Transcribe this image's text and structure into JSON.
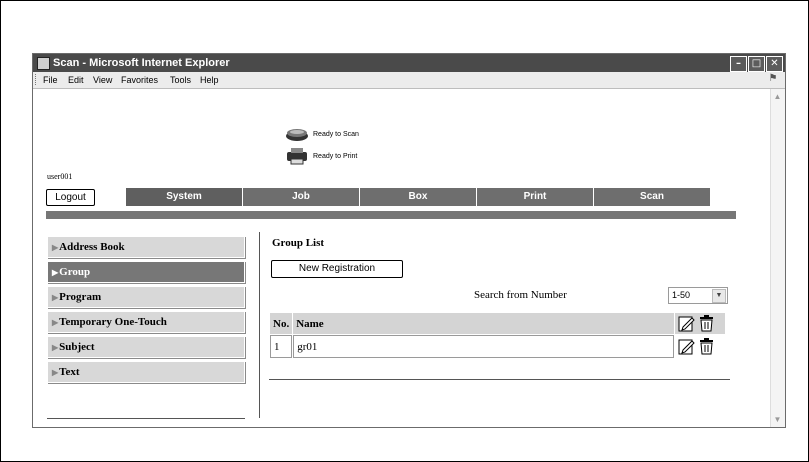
{
  "window": {
    "title": "Scan - Microsoft Internet Explorer"
  },
  "menubar": [
    "File",
    "Edit",
    "View",
    "Favorites",
    "Tools",
    "Help"
  ],
  "status": {
    "scan": "Ready to Scan",
    "print": "Ready to Print"
  },
  "user": {
    "name": "user001",
    "logout_label": "Logout"
  },
  "tabs": [
    "System",
    "Job",
    "Box",
    "Print",
    "Scan"
  ],
  "sidebar": {
    "items": [
      {
        "label": "Address Book",
        "active": false
      },
      {
        "label": "Group",
        "active": true
      },
      {
        "label": "Program",
        "active": false
      },
      {
        "label": "Temporary One-Touch",
        "active": false
      },
      {
        "label": "Subject",
        "active": false
      },
      {
        "label": "Text",
        "active": false
      }
    ]
  },
  "main": {
    "title": "Group List",
    "new_registration_label": "New Registration",
    "search_label": "Search from Number",
    "range_value": "1-50",
    "table": {
      "headers": {
        "no": "No.",
        "name": "Name"
      },
      "rows": [
        {
          "no": "1",
          "name": "gr01"
        }
      ]
    }
  },
  "colors": {
    "titlebar": "#4a4a4a",
    "tab": "#5f5f5f",
    "active_item": "#777777",
    "bar": "#767676"
  },
  "icons": [
    "scanner-icon",
    "printer-icon",
    "edit-icon",
    "delete-icon",
    "ie-icon"
  ]
}
